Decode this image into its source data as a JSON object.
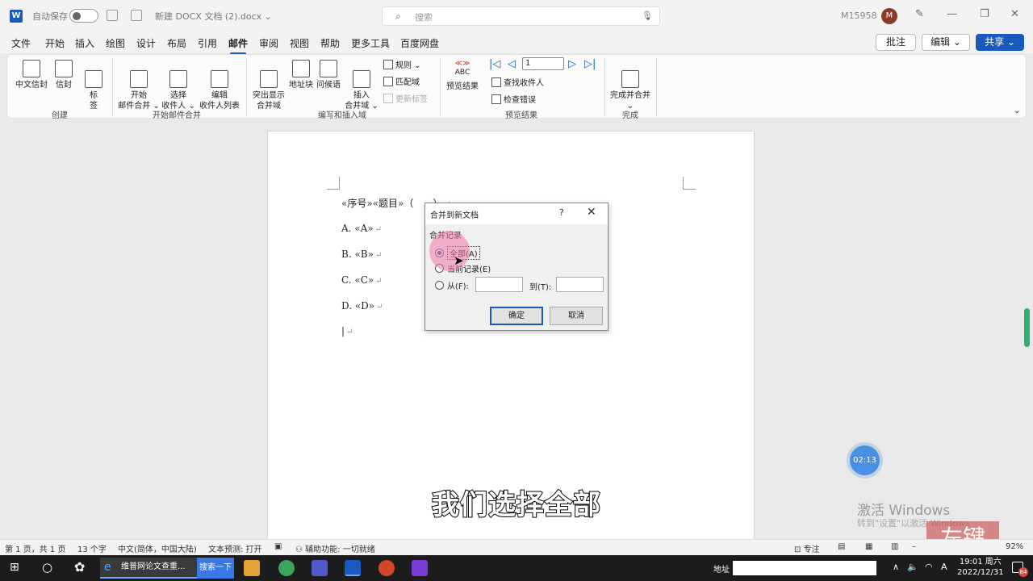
{
  "titlebar": {
    "autosave_label": "自动保存",
    "doc_title": "新建 DOCX 文档 (2).docx ⌄",
    "search_placeholder": "搜索",
    "user_name": "M15958",
    "avatar_letter": "M"
  },
  "tabs": [
    "文件",
    "开始",
    "插入",
    "绘图",
    "设计",
    "布局",
    "引用",
    "邮件",
    "审阅",
    "视图",
    "帮助",
    "更多工具",
    "百度网盘"
  ],
  "tab_actions": {
    "comment": "批注",
    "edit": "编辑 ⌄",
    "share": "共享 ⌄"
  },
  "ribbon": {
    "create": {
      "label": "创建",
      "buttons": [
        "中文信封",
        "信封",
        "标\n签"
      ]
    },
    "start_merge": {
      "label": "开始邮件合并",
      "buttons": [
        "开始\n邮件合并 ⌄",
        "选择\n收件人 ⌄",
        "编辑\n收件人列表"
      ]
    },
    "write_insert": {
      "label": "编写和插入域",
      "buttons": [
        "突出显示\n合并域",
        "地址块",
        "问候语",
        "插入\n合并域 ⌄"
      ],
      "small": [
        "规则 ⌄",
        "匹配域",
        "更新标签"
      ]
    },
    "preview": {
      "label": "预览结果",
      "button": "预览结果",
      "abc": "ABC",
      "record_value": "1",
      "small": [
        "查找收件人",
        "检查错误"
      ]
    },
    "finish": {
      "label": "完成",
      "button": "完成并合并\n⌄"
    }
  },
  "document": {
    "lines": [
      "«序号»«题目»（　　）",
      "A. «A»",
      "B. «B»",
      "C. «C»",
      "D. «D»"
    ],
    "para_mark": "↵"
  },
  "dialog": {
    "title": "合并到新文档",
    "help": "?",
    "close": "✕",
    "group_label": "合并记录",
    "opt_all": "全部(A)",
    "opt_current": "当前记录(E)",
    "opt_from": "从(F):",
    "to_label": "到(T):",
    "ok": "确定",
    "cancel": "取消"
  },
  "overlay": {
    "subtitle": "我们选择全部",
    "timer": "02:13",
    "activate_title": "激活 Windows",
    "activate_sub": "转到\"设置\"以激活 Windows",
    "watermark": "左键"
  },
  "statusbar": {
    "page": "第 1 页，共 1 页",
    "words": "13 个字",
    "lang": "中文(简体，中国大陆)",
    "predict": "文本预测: 打开",
    "accessibility": "辅助功能: 一切就绪",
    "focus": "专注",
    "zoom": "92%"
  },
  "taskbar": {
    "task_label": "维普网论文查重...",
    "search_btn": "搜索一下",
    "addr_label": "地址",
    "time": "19:01 周六",
    "date": "2022/12/31",
    "ime": "A",
    "badge": "84"
  },
  "colors": {
    "accent": "#185abd",
    "halo": "#f078aa"
  }
}
